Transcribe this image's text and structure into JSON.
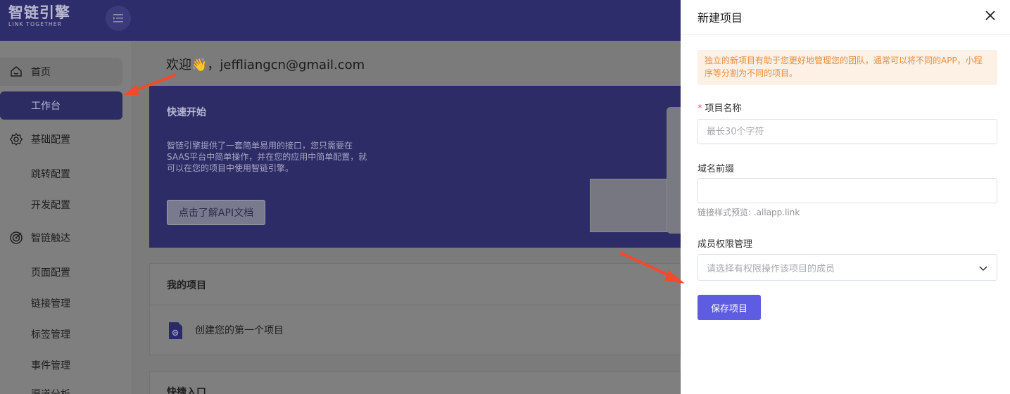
{
  "brand": {
    "name_cn": "智链引擎",
    "name_en": "LINK TOGETHER"
  },
  "sidebar": {
    "items": [
      {
        "label": "首页",
        "icon": "home-icon"
      },
      {
        "label": "工作台"
      },
      {
        "label": "基础配置",
        "icon": "gear-icon"
      },
      {
        "label": "跳转配置"
      },
      {
        "label": "开发配置"
      },
      {
        "label": "智链触达",
        "icon": "target-icon"
      },
      {
        "label": "页面配置"
      },
      {
        "label": "链接管理"
      },
      {
        "label": "标签管理"
      },
      {
        "label": "事件管理"
      },
      {
        "label": "渠道分析"
      }
    ]
  },
  "main": {
    "welcome": "欢迎👋，jeffliangcn@gmail.com",
    "hero": {
      "title": "快速开始",
      "desc": "智链引擎提供了一套简单易用的接口，您只需要在SAAS平台中简单操作，并在您的应用中简单配置，就可以在您的项目中使用智链引擎。",
      "button": "点击了解API文档"
    },
    "my_projects": {
      "title": "我的项目",
      "create": "创建您的第一个项目"
    },
    "quick_entry": {
      "title": "快捷入口"
    }
  },
  "drawer": {
    "title": "新建项目",
    "alert": "独立的新项目有助于您更好地管理您的团队，通常可以将不同的APP，小程序等分割为不同的项目。",
    "project_name": {
      "label": "项目名称",
      "required_mark": "*",
      "placeholder": "最长30个字符",
      "value": ""
    },
    "domain_prefix": {
      "label": "域名前缀",
      "value": "",
      "hint": "链接样式预览: .allapp.link"
    },
    "members": {
      "label": "成员权限管理",
      "placeholder": "请选择有权限操作该项目的成员"
    },
    "save_button": "保存项目"
  },
  "colors": {
    "primary": "#5e5ce0",
    "overlay": "#7d7d7d",
    "alert_bg": "#fdf0e4",
    "alert_text": "#e98d3d",
    "annotation": "#f24a2b"
  }
}
